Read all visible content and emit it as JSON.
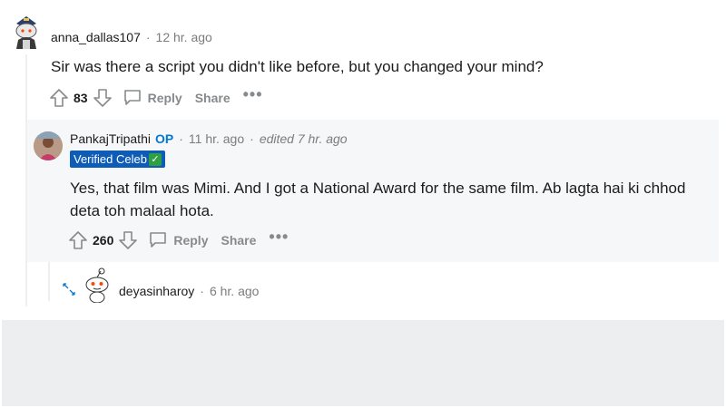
{
  "comment1": {
    "username": "anna_dallas107",
    "time": "12 hr. ago",
    "body": "Sir was there a script you didn't like before, but you changed your mind?",
    "votes": "83",
    "reply_label": "Reply",
    "share_label": "Share",
    "more_label": "•••"
  },
  "comment2": {
    "username": "PankajTripathi",
    "op_badge": "OP",
    "time": "11 hr. ago",
    "edited": "edited 7 hr. ago",
    "flair": "Verified Celeb",
    "flair_check": "✓",
    "body": "Yes, that film was Mimi. And I got a National Award for the same film. Ab lagta hai ki chhod deta toh malaal hota.",
    "votes": "260",
    "reply_label": "Reply",
    "share_label": "Share",
    "more_label": "•••"
  },
  "comment3": {
    "username": "deyasinharoy",
    "time": "6 hr. ago"
  },
  "icons": {
    "upvote": "upvote-arrow-icon",
    "downvote": "downvote-arrow-icon",
    "reply": "speech-bubble-icon",
    "expand": "expand-arrows-icon"
  },
  "colors": {
    "op": "#0079d3",
    "flair_bg": "#0e5cb5",
    "muted": "#7c7c7c",
    "panel": "#f6f7f8"
  }
}
